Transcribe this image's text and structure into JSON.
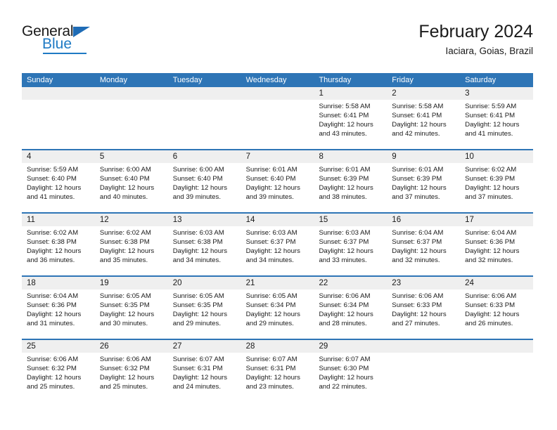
{
  "brand": {
    "name_part1": "General",
    "name_part2": "Blue",
    "accent_color": "#1f7ac4"
  },
  "header": {
    "title": "February 2024",
    "subtitle": "Iaciara, Goias, Brazil"
  },
  "calendar": {
    "header_color": "#2e75b6",
    "day_number_band_color": "#efefef",
    "day_names": [
      "Sunday",
      "Monday",
      "Tuesday",
      "Wednesday",
      "Thursday",
      "Friday",
      "Saturday"
    ],
    "weeks": [
      [
        {
          "day": "",
          "sunrise": "",
          "sunset": "",
          "daylight_line1": "",
          "daylight_line2": ""
        },
        {
          "day": "",
          "sunrise": "",
          "sunset": "",
          "daylight_line1": "",
          "daylight_line2": ""
        },
        {
          "day": "",
          "sunrise": "",
          "sunset": "",
          "daylight_line1": "",
          "daylight_line2": ""
        },
        {
          "day": "",
          "sunrise": "",
          "sunset": "",
          "daylight_line1": "",
          "daylight_line2": ""
        },
        {
          "day": "1",
          "sunrise": "Sunrise: 5:58 AM",
          "sunset": "Sunset: 6:41 PM",
          "daylight_line1": "Daylight: 12 hours",
          "daylight_line2": "and 43 minutes."
        },
        {
          "day": "2",
          "sunrise": "Sunrise: 5:58 AM",
          "sunset": "Sunset: 6:41 PM",
          "daylight_line1": "Daylight: 12 hours",
          "daylight_line2": "and 42 minutes."
        },
        {
          "day": "3",
          "sunrise": "Sunrise: 5:59 AM",
          "sunset": "Sunset: 6:41 PM",
          "daylight_line1": "Daylight: 12 hours",
          "daylight_line2": "and 41 minutes."
        }
      ],
      [
        {
          "day": "4",
          "sunrise": "Sunrise: 5:59 AM",
          "sunset": "Sunset: 6:40 PM",
          "daylight_line1": "Daylight: 12 hours",
          "daylight_line2": "and 41 minutes."
        },
        {
          "day": "5",
          "sunrise": "Sunrise: 6:00 AM",
          "sunset": "Sunset: 6:40 PM",
          "daylight_line1": "Daylight: 12 hours",
          "daylight_line2": "and 40 minutes."
        },
        {
          "day": "6",
          "sunrise": "Sunrise: 6:00 AM",
          "sunset": "Sunset: 6:40 PM",
          "daylight_line1": "Daylight: 12 hours",
          "daylight_line2": "and 39 minutes."
        },
        {
          "day": "7",
          "sunrise": "Sunrise: 6:01 AM",
          "sunset": "Sunset: 6:40 PM",
          "daylight_line1": "Daylight: 12 hours",
          "daylight_line2": "and 39 minutes."
        },
        {
          "day": "8",
          "sunrise": "Sunrise: 6:01 AM",
          "sunset": "Sunset: 6:39 PM",
          "daylight_line1": "Daylight: 12 hours",
          "daylight_line2": "and 38 minutes."
        },
        {
          "day": "9",
          "sunrise": "Sunrise: 6:01 AM",
          "sunset": "Sunset: 6:39 PM",
          "daylight_line1": "Daylight: 12 hours",
          "daylight_line2": "and 37 minutes."
        },
        {
          "day": "10",
          "sunrise": "Sunrise: 6:02 AM",
          "sunset": "Sunset: 6:39 PM",
          "daylight_line1": "Daylight: 12 hours",
          "daylight_line2": "and 37 minutes."
        }
      ],
      [
        {
          "day": "11",
          "sunrise": "Sunrise: 6:02 AM",
          "sunset": "Sunset: 6:38 PM",
          "daylight_line1": "Daylight: 12 hours",
          "daylight_line2": "and 36 minutes."
        },
        {
          "day": "12",
          "sunrise": "Sunrise: 6:02 AM",
          "sunset": "Sunset: 6:38 PM",
          "daylight_line1": "Daylight: 12 hours",
          "daylight_line2": "and 35 minutes."
        },
        {
          "day": "13",
          "sunrise": "Sunrise: 6:03 AM",
          "sunset": "Sunset: 6:38 PM",
          "daylight_line1": "Daylight: 12 hours",
          "daylight_line2": "and 34 minutes."
        },
        {
          "day": "14",
          "sunrise": "Sunrise: 6:03 AM",
          "sunset": "Sunset: 6:37 PM",
          "daylight_line1": "Daylight: 12 hours",
          "daylight_line2": "and 34 minutes."
        },
        {
          "day": "15",
          "sunrise": "Sunrise: 6:03 AM",
          "sunset": "Sunset: 6:37 PM",
          "daylight_line1": "Daylight: 12 hours",
          "daylight_line2": "and 33 minutes."
        },
        {
          "day": "16",
          "sunrise": "Sunrise: 6:04 AM",
          "sunset": "Sunset: 6:37 PM",
          "daylight_line1": "Daylight: 12 hours",
          "daylight_line2": "and 32 minutes."
        },
        {
          "day": "17",
          "sunrise": "Sunrise: 6:04 AM",
          "sunset": "Sunset: 6:36 PM",
          "daylight_line1": "Daylight: 12 hours",
          "daylight_line2": "and 32 minutes."
        }
      ],
      [
        {
          "day": "18",
          "sunrise": "Sunrise: 6:04 AM",
          "sunset": "Sunset: 6:36 PM",
          "daylight_line1": "Daylight: 12 hours",
          "daylight_line2": "and 31 minutes."
        },
        {
          "day": "19",
          "sunrise": "Sunrise: 6:05 AM",
          "sunset": "Sunset: 6:35 PM",
          "daylight_line1": "Daylight: 12 hours",
          "daylight_line2": "and 30 minutes."
        },
        {
          "day": "20",
          "sunrise": "Sunrise: 6:05 AM",
          "sunset": "Sunset: 6:35 PM",
          "daylight_line1": "Daylight: 12 hours",
          "daylight_line2": "and 29 minutes."
        },
        {
          "day": "21",
          "sunrise": "Sunrise: 6:05 AM",
          "sunset": "Sunset: 6:34 PM",
          "daylight_line1": "Daylight: 12 hours",
          "daylight_line2": "and 29 minutes."
        },
        {
          "day": "22",
          "sunrise": "Sunrise: 6:06 AM",
          "sunset": "Sunset: 6:34 PM",
          "daylight_line1": "Daylight: 12 hours",
          "daylight_line2": "and 28 minutes."
        },
        {
          "day": "23",
          "sunrise": "Sunrise: 6:06 AM",
          "sunset": "Sunset: 6:33 PM",
          "daylight_line1": "Daylight: 12 hours",
          "daylight_line2": "and 27 minutes."
        },
        {
          "day": "24",
          "sunrise": "Sunrise: 6:06 AM",
          "sunset": "Sunset: 6:33 PM",
          "daylight_line1": "Daylight: 12 hours",
          "daylight_line2": "and 26 minutes."
        }
      ],
      [
        {
          "day": "25",
          "sunrise": "Sunrise: 6:06 AM",
          "sunset": "Sunset: 6:32 PM",
          "daylight_line1": "Daylight: 12 hours",
          "daylight_line2": "and 25 minutes."
        },
        {
          "day": "26",
          "sunrise": "Sunrise: 6:06 AM",
          "sunset": "Sunset: 6:32 PM",
          "daylight_line1": "Daylight: 12 hours",
          "daylight_line2": "and 25 minutes."
        },
        {
          "day": "27",
          "sunrise": "Sunrise: 6:07 AM",
          "sunset": "Sunset: 6:31 PM",
          "daylight_line1": "Daylight: 12 hours",
          "daylight_line2": "and 24 minutes."
        },
        {
          "day": "28",
          "sunrise": "Sunrise: 6:07 AM",
          "sunset": "Sunset: 6:31 PM",
          "daylight_line1": "Daylight: 12 hours",
          "daylight_line2": "and 23 minutes."
        },
        {
          "day": "29",
          "sunrise": "Sunrise: 6:07 AM",
          "sunset": "Sunset: 6:30 PM",
          "daylight_line1": "Daylight: 12 hours",
          "daylight_line2": "and 22 minutes."
        },
        {
          "day": "",
          "sunrise": "",
          "sunset": "",
          "daylight_line1": "",
          "daylight_line2": ""
        },
        {
          "day": "",
          "sunrise": "",
          "sunset": "",
          "daylight_line1": "",
          "daylight_line2": ""
        }
      ]
    ]
  }
}
